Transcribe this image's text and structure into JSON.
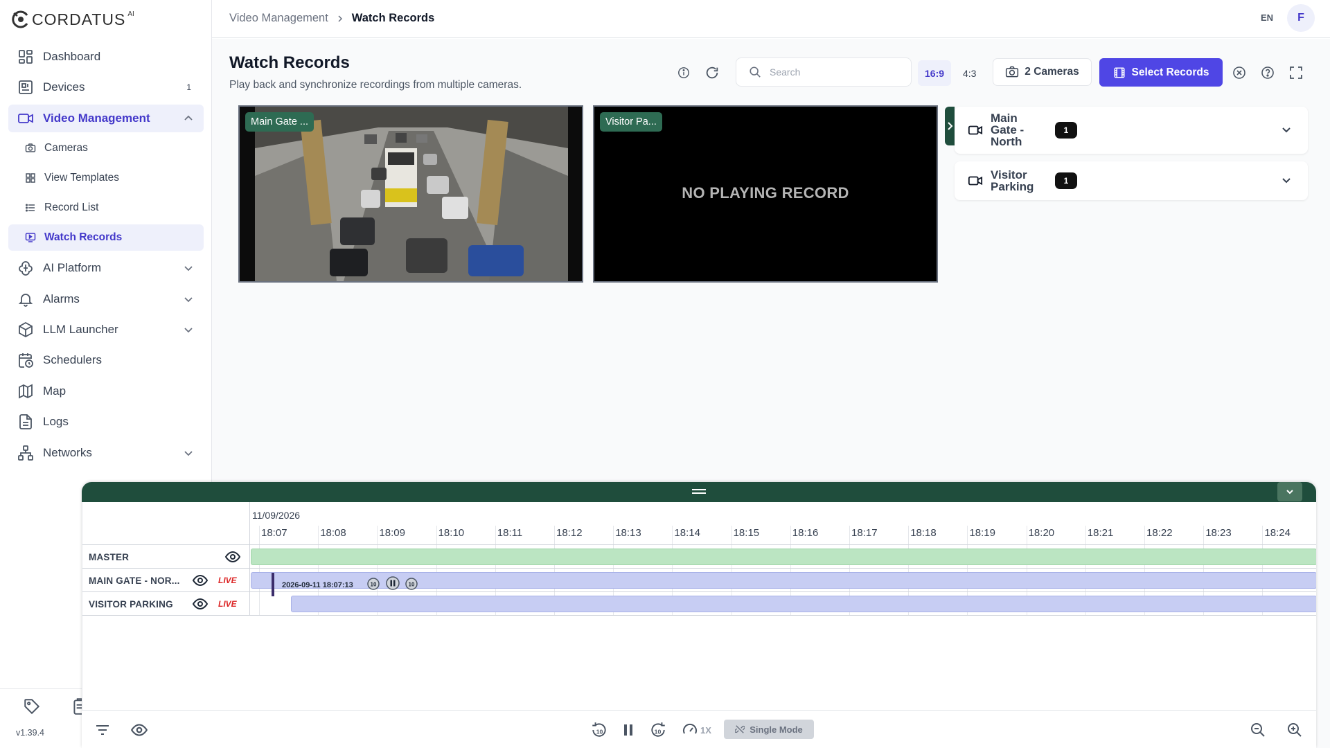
{
  "app": {
    "brand": "CORDATUS",
    "brand_sup": "AI",
    "version": "v1.39.4"
  },
  "sidebar": {
    "items": [
      {
        "label": "Dashboard",
        "icon": "dashboard-icon"
      },
      {
        "label": "Devices",
        "icon": "devices-icon",
        "badge": "1"
      },
      {
        "label": "Video Management",
        "icon": "video-icon",
        "expanded": true
      },
      {
        "label": "AI Platform",
        "icon": "ai-icon"
      },
      {
        "label": "Alarms",
        "icon": "bell-icon"
      },
      {
        "label": "LLM Launcher",
        "icon": "cube-icon"
      },
      {
        "label": "Schedulers",
        "icon": "calendar-clock-icon"
      },
      {
        "label": "Map",
        "icon": "map-icon"
      },
      {
        "label": "Logs",
        "icon": "document-icon"
      },
      {
        "label": "Networks",
        "icon": "network-icon"
      }
    ],
    "sub_items": [
      {
        "label": "Cameras",
        "icon": "camera-icon"
      },
      {
        "label": "View Templates",
        "icon": "grid-icon"
      },
      {
        "label": "Record List",
        "icon": "list-icon"
      },
      {
        "label": "Watch Records",
        "icon": "monitor-play-icon",
        "active": true
      }
    ]
  },
  "header": {
    "breadcrumb": [
      "Video Management",
      "Watch Records"
    ],
    "lang": "EN",
    "avatar": "F"
  },
  "page": {
    "title": "Watch Records",
    "subtitle": "Play back and synchronize recordings from multiple cameras."
  },
  "toolbar": {
    "search_placeholder": "Search",
    "ratios": [
      "16:9",
      "4:3"
    ],
    "active_ratio": "16:9",
    "cameras_button": "2 Cameras",
    "select_records_button": "Select Records"
  },
  "tiles": [
    {
      "label": "Main Gate ...",
      "status": ""
    },
    {
      "label": "Visitor Pa...",
      "status": "NO PLAYING RECORD"
    }
  ],
  "camera_panel": [
    {
      "name": "Main Gate - North",
      "count": "1"
    },
    {
      "name": "Visitor Parking",
      "count": "1"
    }
  ],
  "timeline": {
    "date": "11/09/2026",
    "ticks": [
      "18:07",
      "18:08",
      "18:09",
      "18:10",
      "18:11",
      "18:12",
      "18:13",
      "18:14",
      "18:15",
      "18:16",
      "18:17",
      "18:18",
      "18:19",
      "18:20",
      "18:21",
      "18:22",
      "18:23",
      "18:24"
    ],
    "rows": [
      {
        "name": "MASTER",
        "live": ""
      },
      {
        "name": "MAIN GATE - NOR...",
        "live": "LIVE"
      },
      {
        "name": "VISITOR PARKING",
        "live": "LIVE"
      }
    ],
    "current_time": "2026-09-11 18:07:13",
    "speed": "1X",
    "mode": "Single Mode",
    "colors": {
      "master": "#bbe5c2",
      "track": "#c7cdf3",
      "header": "#1f4d3c"
    }
  }
}
